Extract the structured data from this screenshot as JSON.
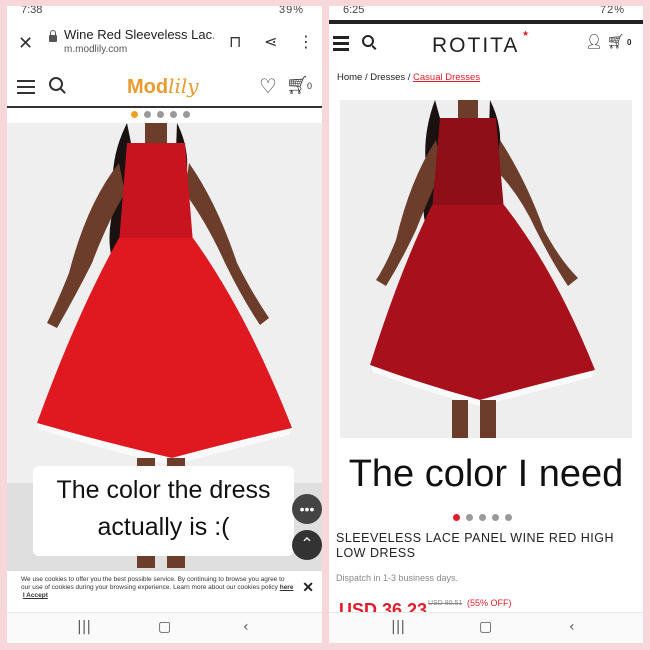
{
  "colors": {
    "accent_left": "#f0a020",
    "accent_right": "#e01c2a",
    "dress_red": "#c8141e",
    "page_bg": "#f7d7d9"
  },
  "left": {
    "status": {
      "time": "7:38",
      "right_text": "39%"
    },
    "browser": {
      "tab_title": "Wine Red Sleeveless Lac...",
      "url": "m.modlily.com",
      "icons": [
        "close-icon",
        "lock-icon",
        "bookmark-icon",
        "share-icon",
        "more-icon"
      ]
    },
    "site": {
      "logo_part1": "Mod",
      "logo_part2": "lily",
      "cart_count": "0"
    },
    "carousel": {
      "count": 5,
      "active": 0
    },
    "caption": {
      "line1": "The color the dress",
      "line2": "actually is :("
    },
    "cookie": {
      "text": "We use cookies to offer you the best possible service. By continuing to browse you agree to our use of cookies during your browsing experience. Learn more about our cookies policy",
      "link_here": "here",
      "accept": "I Accept"
    }
  },
  "right": {
    "status": {
      "time": "6:25",
      "right_text": "72%"
    },
    "site": {
      "logo": "ROTITA",
      "cart_count": "0"
    },
    "breadcrumb": {
      "home": "Home",
      "dresses": "Dresses",
      "current": "Casual Dresses"
    },
    "caption": "The color I need",
    "carousel": {
      "count": 5,
      "active": 0
    },
    "product": {
      "title": "SLEEVELESS LACE PANEL WINE RED HIGH LOW DRESS",
      "dispatch": "Dispatch in 1-3 business days.",
      "price": "USD 36.23",
      "old_price": "USD 80.51",
      "discount": "(55% OFF)"
    }
  },
  "system_nav": {
    "recent": "|||",
    "home": "▢",
    "back": "‹"
  }
}
